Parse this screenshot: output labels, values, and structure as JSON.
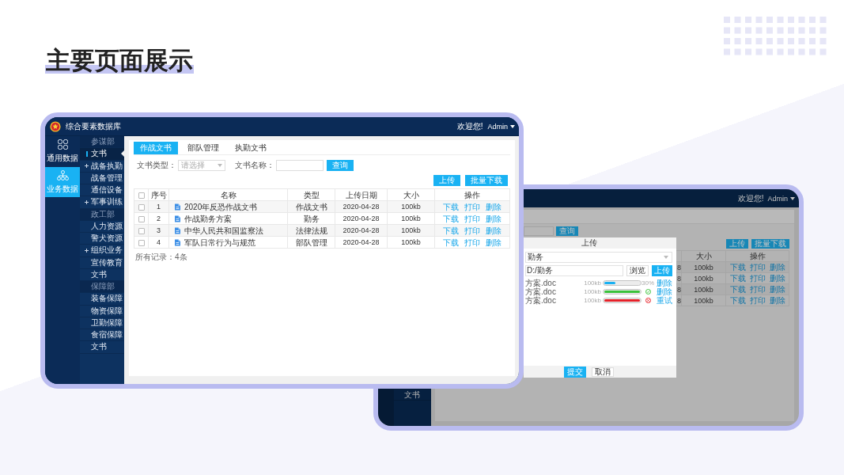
{
  "slide": {
    "title": "主要页面展示"
  },
  "main_window": {
    "app_title": "综合要素数据库",
    "welcome": "欢迎您!",
    "user": "Admin",
    "nav_rail": [
      {
        "label": "通用数据",
        "selected": false
      },
      {
        "label": "业务数据",
        "selected": true
      }
    ],
    "menu": [
      {
        "label": "参谋部",
        "kind": "group",
        "selected": false
      },
      {
        "label": "文书",
        "kind": "page",
        "selected": true
      },
      {
        "label": "战备执勤",
        "kind": "folder",
        "selected": false
      },
      {
        "label": "战备管理",
        "kind": "page",
        "selected": false
      },
      {
        "label": "通信设备",
        "kind": "page",
        "selected": false
      },
      {
        "label": "军事训练",
        "kind": "folder",
        "selected": false
      },
      {
        "label": "政工部",
        "kind": "group",
        "selected": false
      },
      {
        "label": "人力资源",
        "kind": "page",
        "selected": false
      },
      {
        "label": "警犬资源",
        "kind": "page",
        "selected": false
      },
      {
        "label": "组织业务",
        "kind": "folder",
        "selected": false
      },
      {
        "label": "宣传教育",
        "kind": "page",
        "selected": false
      },
      {
        "label": "文书",
        "kind": "page",
        "selected": false
      },
      {
        "label": "保障部",
        "kind": "group",
        "selected": false
      },
      {
        "label": "装备保障",
        "kind": "page",
        "selected": false
      },
      {
        "label": "物资保障",
        "kind": "page",
        "selected": false
      },
      {
        "label": "卫勤保障",
        "kind": "page",
        "selected": false
      },
      {
        "label": "食宿保障",
        "kind": "page",
        "selected": false
      },
      {
        "label": "文书",
        "kind": "page",
        "selected": false
      }
    ],
    "tabs": [
      {
        "label": "作战文书",
        "selected": true
      },
      {
        "label": "部队管理",
        "selected": false
      },
      {
        "label": "执勤文书",
        "selected": false
      }
    ],
    "filters": {
      "type_label": "文书类型：",
      "type_placeholder": "请选择",
      "name_label": "文书名称：",
      "query_button": "查询"
    },
    "actions": [
      "上传",
      "批量下载"
    ],
    "table": {
      "all_checked": false,
      "columns": [
        "序号",
        "名称",
        "类型",
        "上传日期",
        "大小",
        "操作"
      ],
      "rows": [
        {
          "checked": false,
          "index": "1",
          "name": "2020年反恐作战文书",
          "type": "作战文书",
          "date": "2020-04-28",
          "size": "100kb",
          "actions": [
            "下载",
            "打印",
            "删除"
          ]
        },
        {
          "checked": false,
          "index": "2",
          "name": "作战勤务方案",
          "type": "勤务",
          "date": "2020-04-28",
          "size": "100kb",
          "actions": [
            "下载",
            "打印",
            "删除"
          ]
        },
        {
          "checked": false,
          "index": "3",
          "name": "中华人民共和国监察法",
          "type": "法律法规",
          "date": "2020-04-28",
          "size": "100kb",
          "actions": [
            "下载",
            "打印",
            "删除"
          ]
        },
        {
          "checked": false,
          "index": "4",
          "name": "军队日常行为与规范",
          "type": "部队管理",
          "date": "2020-04-28",
          "size": "100kb",
          "actions": [
            "下载",
            "打印",
            "删除"
          ]
        }
      ]
    },
    "record_count": "所有记录：4条"
  },
  "upload_window": {
    "welcome": "欢迎您!",
    "user": "Admin",
    "menu": [
      {
        "label": "文书",
        "selected": false
      }
    ],
    "query_button": "查询",
    "actions": [
      "上传",
      "批量下载"
    ],
    "table": {
      "columns": [
        "大小",
        "操作"
      ],
      "rows": [
        {
          "date_tail": "8",
          "size": "100kb",
          "actions": [
            "下载",
            "打印",
            "删除"
          ]
        },
        {
          "date_tail": "8",
          "size": "100kb",
          "actions": [
            "下载",
            "打印",
            "删除"
          ]
        },
        {
          "date_tail": "8",
          "size": "100kb",
          "actions": [
            "下载",
            "打印",
            "删除"
          ]
        },
        {
          "date_tail": "8",
          "size": "100kb",
          "actions": [
            "下载",
            "打印",
            "删除"
          ]
        }
      ]
    },
    "dialog": {
      "title": "上传",
      "type_value": "勤务",
      "path_value": "D:/勤务",
      "browse_button": "浏览",
      "upload_button": "上传",
      "files": [
        {
          "name": "方案.doc",
          "size": "100kb",
          "level": 0.3,
          "kind": "uploading",
          "percent": "30%",
          "action": "删除"
        },
        {
          "name": "方案.doc",
          "size": "100kb",
          "level": 1,
          "kind": "done",
          "action": "删除"
        },
        {
          "name": "方案.doc",
          "size": "100kb",
          "level": 1,
          "kind": "failed",
          "action": "重试"
        }
      ],
      "buttons": [
        "提交",
        "取消"
      ]
    }
  }
}
